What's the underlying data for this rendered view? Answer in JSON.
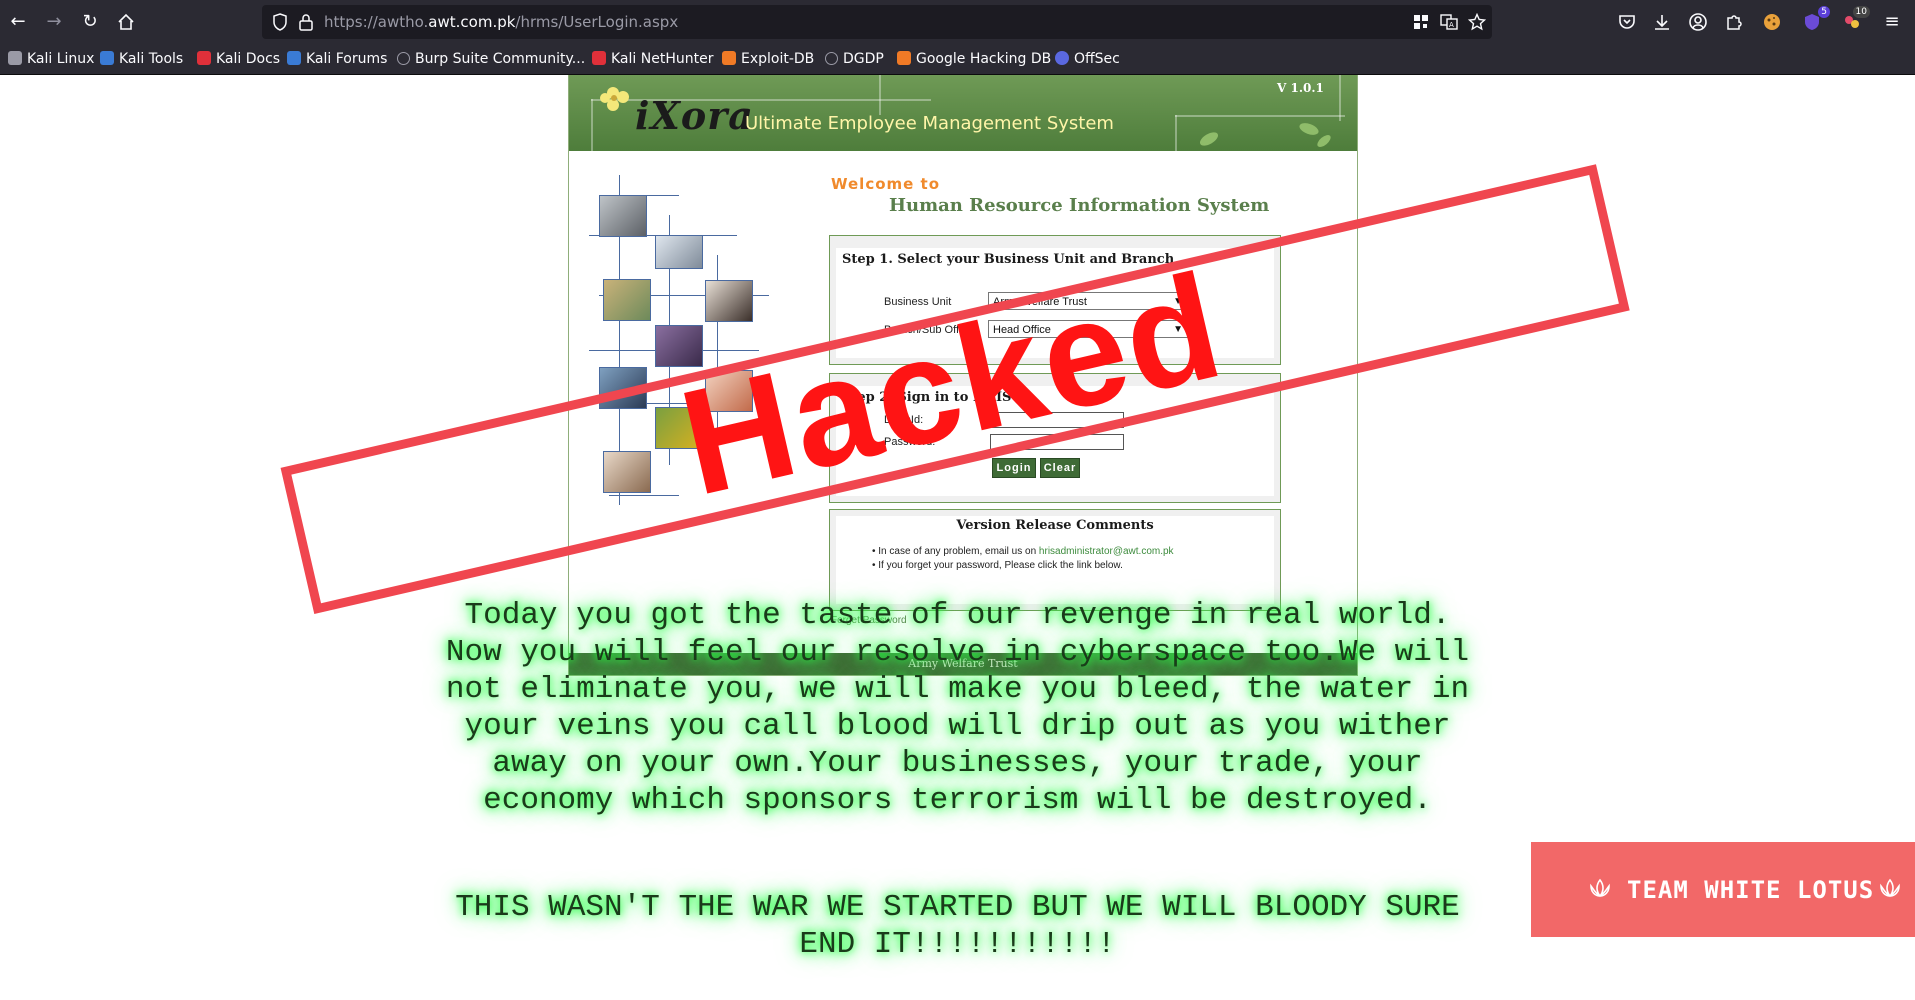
{
  "browser": {
    "url_prefix": "https://awtho.",
    "url_host": "awt.com.pk",
    "url_path": "/hrms/UserLogin.aspx",
    "extension_badge": "5",
    "extension_badge_2": "10"
  },
  "bookmarks": [
    {
      "label": "Kali Linux",
      "color": "#9a9aa6"
    },
    {
      "label": "Kali Tools",
      "color": "#3a7bd5"
    },
    {
      "label": "Kali Docs",
      "color": "#e0303a"
    },
    {
      "label": "Kali Forums",
      "color": "#3a7bd5"
    },
    {
      "label": "Burp Suite Community...",
      "color": "#9a9aa6"
    },
    {
      "label": "Kali NetHunter",
      "color": "#e0303a"
    },
    {
      "label": "Exploit-DB",
      "color": "#f07a26"
    },
    {
      "label": "DGDP",
      "color": "#9a9aa6"
    },
    {
      "label": "Google Hacking DB",
      "color": "#f07a26"
    },
    {
      "label": "OffSec",
      "color": "#5a68e0"
    }
  ],
  "app": {
    "logo": "iXora",
    "subtitle": "Ultimate Employee Management System",
    "version": "V 1.0.1",
    "welcome": "Welcome to",
    "system_title": "Human Resource Information System",
    "step1_title": "Step 1. Select your Business Unit and Branch",
    "business_unit_label": "Business Unit",
    "business_unit_value": "Army Welfare Trust",
    "branch_label": "Branch/Sub Office",
    "branch_value": "Head Office",
    "step2_title": "Step 2. Sign in to HRIS",
    "login_id_label": "LoginId:",
    "password_label": "Password:",
    "login_button": "Login",
    "clear_button": "Clear",
    "release_title": "Version Release Comments",
    "bullet1_prefix": "In case of any problem, email us on ",
    "bullet1_email": "hrisadministrator@awt.com.pk",
    "bullet2": "If you forget your password, Please click the link below.",
    "forgot_link": "Forget Password",
    "footer": "Army Welfare Trust"
  },
  "deface": {
    "stamp": "Hacked",
    "message": "Today you got the taste of our revenge in real world. Now you will feel our resolve in cyberspace too.We will not eliminate you, we will make you bleed, the water in your veins you call blood will drip out as you wither away on your own.Your businesses, your trade, your economy which sponsors terrorism will be destroyed.",
    "message_2": "THIS WASN'T THE WAR WE STARTED BUT WE WILL BLOODY SURE END IT!!!!!!!!!!!",
    "team": "TEAM WHITE LOTUS",
    "accent": "#f26868",
    "stamp_color": "#ff1414",
    "glow_color": "#39ff5b"
  }
}
